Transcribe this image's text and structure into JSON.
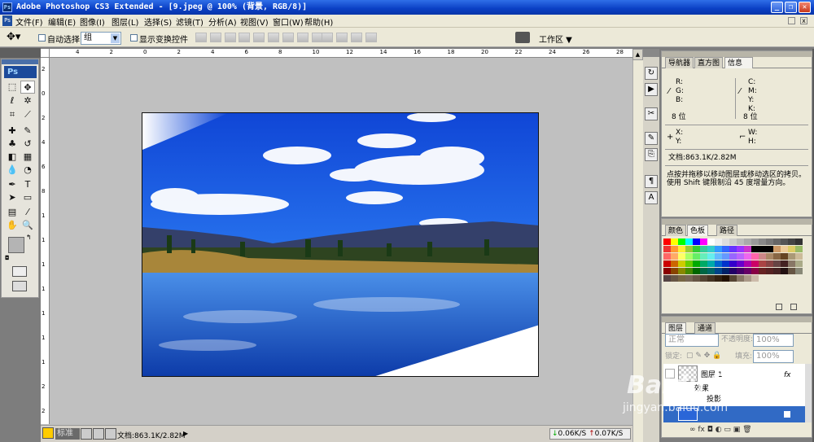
{
  "titlebar": {
    "title": "Adobe Photoshop CS3 Extended - [9.jpeg @ 100% (背景, RGB/8)]",
    "app_icon": "Ps"
  },
  "menu": [
    "文件(F)",
    "编辑(E)",
    "图像(I)",
    "图层(L)",
    "选择(S)",
    "滤镜(T)",
    "分析(A)",
    "视图(V)",
    "窗口(W)",
    "帮助(H)"
  ],
  "options": {
    "auto_select_label": "自动选择:",
    "auto_select_value": "组",
    "show_transform_label": "显示变换控件",
    "workspace_label": "工作区 ▼"
  },
  "toolbox": {
    "logo": "Ps"
  },
  "ruler_h": [
    "4",
    "2",
    "0",
    "2",
    "4",
    "6",
    "8",
    "10",
    "12",
    "14",
    "16",
    "18",
    "20",
    "22",
    "24",
    "26",
    "28"
  ],
  "ruler_v": [
    "2",
    "0",
    "2",
    "4",
    "6",
    "8",
    "1",
    "1",
    "1",
    "1",
    "1",
    "1",
    "1",
    "2",
    "2"
  ],
  "status": {
    "zoom_mode": "标准",
    "doc_size": "文档:863.1K/2.82M",
    "speed_down": "0.06K/S",
    "speed_up": "0.07K/S"
  },
  "navigator": {
    "tabs": [
      "导航器",
      "直方图",
      "信息"
    ],
    "r": "R:",
    "g": "G:",
    "b": "B:",
    "c": "C:",
    "m": "M:",
    "y": "Y:",
    "k": "K:",
    "bit1": "8 位",
    "bit2": "8 位",
    "x": "X:",
    "yy": "Y:",
    "w": "W:",
    "h": "H:",
    "doc": "文档:863.1K/2.82M",
    "help": "点按并拖移以移动图层或移动选区的拷贝。使用 Shift 键限制沿 45 度增量方向。"
  },
  "swatches": {
    "tabs": [
      "颜色",
      "色板",
      "路径"
    ]
  },
  "layers": {
    "tabs": [
      "图层",
      "通道"
    ],
    "blend": "正常",
    "opacity_label": "不透明度:",
    "opacity": "100%",
    "lock_label": "锁定:",
    "fill_label": "填充:",
    "fill": "100%",
    "layer1": "图层 1",
    "fx": "fx",
    "effects": "效果",
    "shadow": "投影"
  },
  "watermark": {
    "line1": "Baidu经验",
    "line2": "jingyan.baidu.com"
  },
  "colors": {
    "title": "#0a3fc4",
    "accent": "#1c4a9a"
  }
}
